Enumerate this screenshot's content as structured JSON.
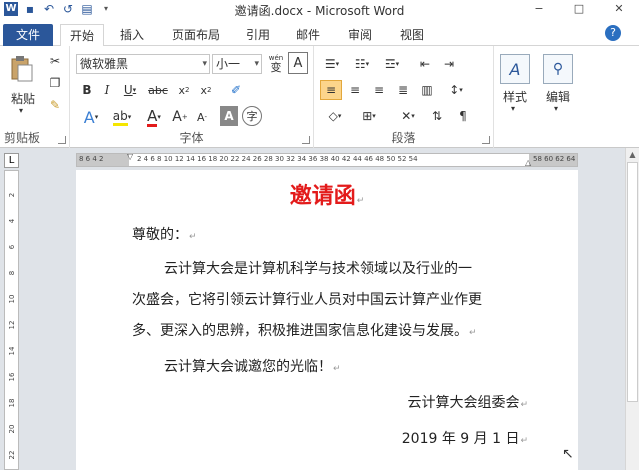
{
  "app": {
    "title": "邀请函.docx - Microsoft Word",
    "icon": "W"
  },
  "window_controls": {
    "minimize": "−",
    "restore": "□",
    "close": "✕"
  },
  "tabs": [
    {
      "label": "文件"
    },
    {
      "label": "开始"
    },
    {
      "label": "插入"
    },
    {
      "label": "页面布局"
    },
    {
      "label": "引用"
    },
    {
      "label": "邮件"
    },
    {
      "label": "审阅"
    },
    {
      "label": "视图"
    }
  ],
  "ribbon": {
    "clipboard": {
      "label": "剪贴板",
      "paste_label": "粘贴"
    },
    "font": {
      "label": "字体",
      "font_name": "微软雅黑",
      "font_size": "小一",
      "wen": "wén",
      "wen_char": "变",
      "a_char": "A"
    },
    "paragraph": {
      "label": "段落"
    },
    "styles": {
      "label": "样式"
    },
    "editing": {
      "label": "编辑"
    }
  },
  "ruler": {
    "left_numbers": "8  6  4  2",
    "numbers": "2   4   6   8  10  12  14  16  18  20  22  24  26  28  30  32  34  36  38  40  42  44  46  48  50  52  54",
    "right_numbers": "58 60 62 64",
    "vertical": [
      "2",
      "4",
      "6",
      "8",
      "10",
      "12",
      "14",
      "16",
      "18",
      "20",
      "22"
    ]
  },
  "document": {
    "title": "邀请函",
    "greeting": "尊敬的：",
    "body_line1": "云计算大会是计算机科学与技术领域以及行业的一",
    "body_line2": "次盛会，它将引领云计算行业人员对中国云计算产业作更",
    "body_line3": "多、更深入的思辨，积极推进国家信息化建设与发展。",
    "invite": "云计算大会诚邀您的光临！",
    "signature": "云计算大会组委会",
    "date": "2019 年 9 月 1 日",
    "para_mark": "↵"
  },
  "colors": {
    "file_tab": "#2b579a",
    "title_red": "#e31b1b"
  }
}
